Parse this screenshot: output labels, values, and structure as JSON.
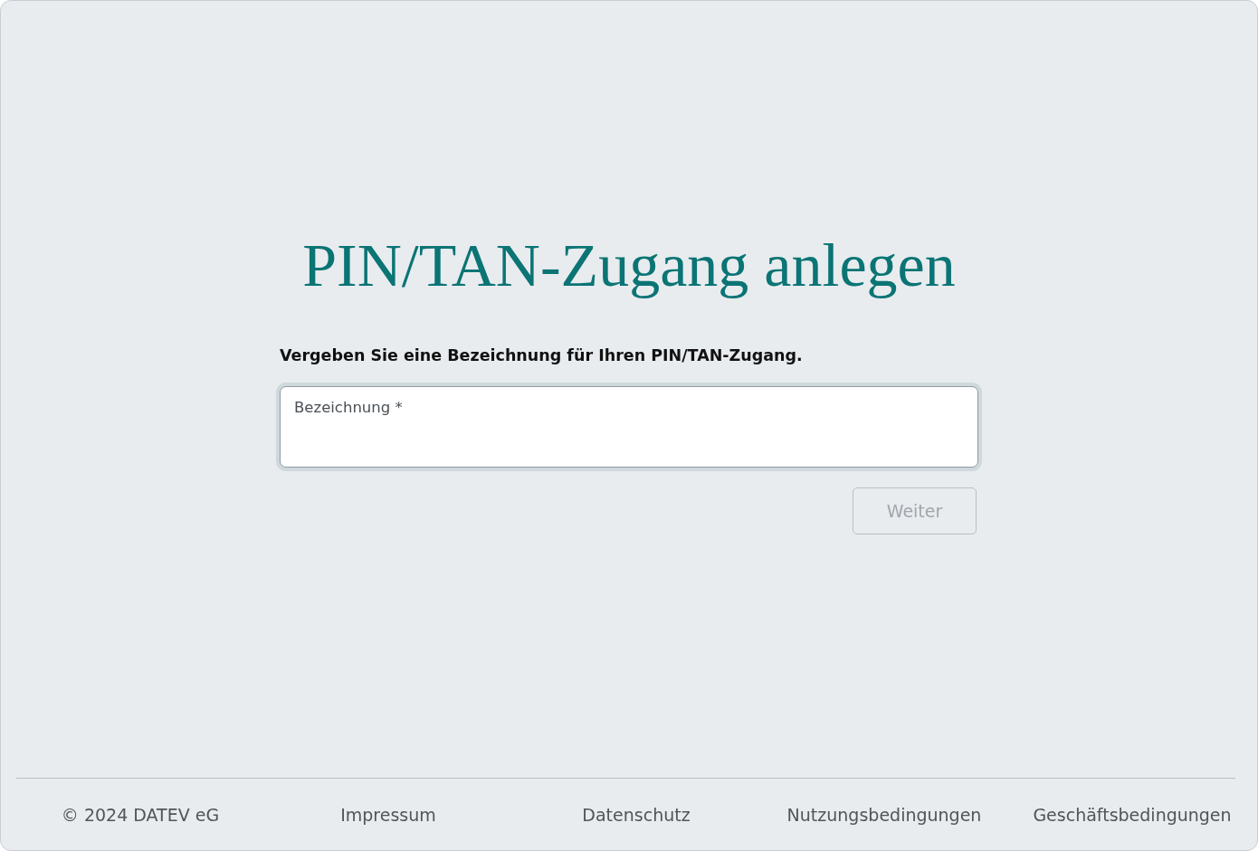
{
  "title": "PIN/TAN-Zugang anlegen",
  "instruction": "Vergeben Sie eine Bezeichnung für Ihren PIN/TAN-Zugang.",
  "field": {
    "label": "Bezeichnung *",
    "focused": true
  },
  "button": {
    "label": "Weiter",
    "disabled": true
  },
  "footer": {
    "copyright": "© 2024 DATEV eG",
    "links": [
      {
        "label": "Impressum"
      },
      {
        "label": "Datenschutz"
      },
      {
        "label": "Nutzungsbedingungen"
      },
      {
        "label": "Geschäftsbedingungen"
      }
    ]
  }
}
